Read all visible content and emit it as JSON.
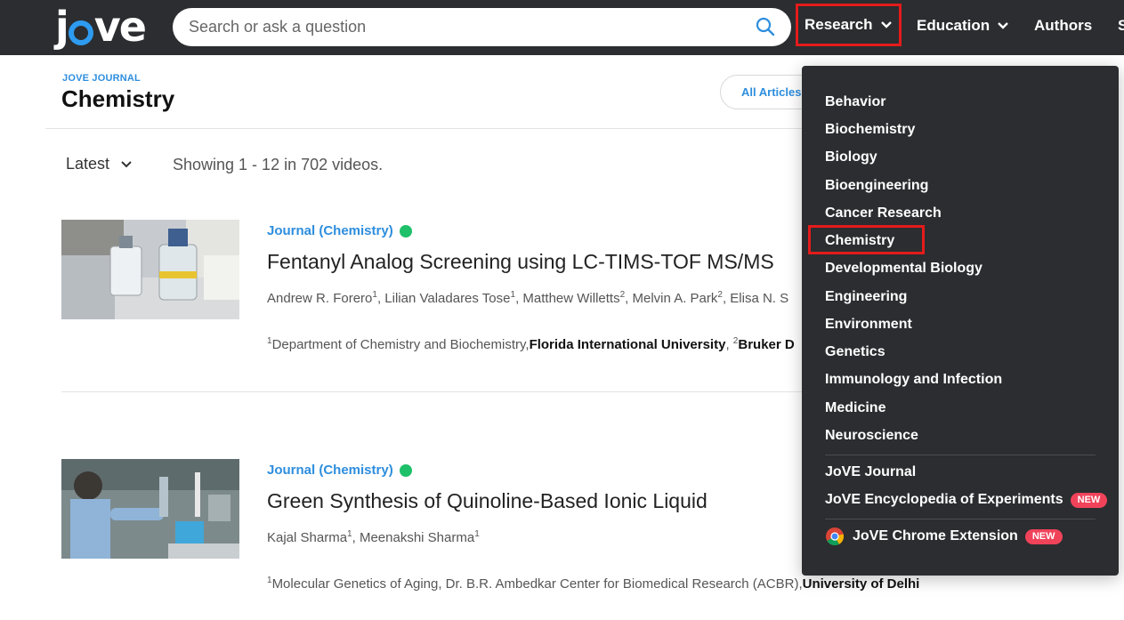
{
  "header": {
    "logo": "jove",
    "search_placeholder": "Search or ask a question",
    "nav": {
      "research": "Research",
      "education": "Education",
      "authors": "Authors",
      "more": "S"
    }
  },
  "page": {
    "tag": "JOVE JOURNAL",
    "title": "Chemistry",
    "filter_pill": "All Articles",
    "sort_label": "Latest",
    "showing": "Showing 1 - 12 in 702 videos."
  },
  "articles": [
    {
      "journal": "Journal (Chemistry)",
      "title": "Fentanyl Analog Screening using LC-TIMS-TOF MS/MS",
      "authors": [
        {
          "name": "Andrew R. Forero",
          "sup": "1"
        },
        {
          "name": "Lilian Valadares Tose",
          "sup": "1"
        },
        {
          "name": "Matthew Willetts",
          "sup": "2"
        },
        {
          "name": "Melvin A. Park",
          "sup": "2"
        },
        {
          "name": "Elisa N. S",
          "sup": ""
        }
      ],
      "affil_sup1": "1",
      "affil_dept": "Department of Chemistry and Biochemistry,",
      "affil_inst": "Florida International University",
      "affil_sep": ", ",
      "affil_sup2": "2",
      "affil_inst2": "Bruker D"
    },
    {
      "journal": "Journal (Chemistry)",
      "title": "Green Synthesis of Quinoline-Based Ionic Liquid",
      "authors": [
        {
          "name": "Kajal Sharma",
          "sup": "1"
        },
        {
          "name": "Meenakshi Sharma",
          "sup": "1"
        }
      ],
      "affil_sup1": "1",
      "affil_dept": "Molecular Genetics of Aging, Dr. B.R. Ambedkar Center for Biomedical Research (ACBR),",
      "affil_inst": "University of Delhi"
    }
  ],
  "dropdown": {
    "subjects": [
      "Behavior",
      "Biochemistry",
      "Biology",
      "Bioengineering",
      "Cancer Research",
      "Chemistry",
      "Developmental Biology",
      "Engineering",
      "Environment",
      "Genetics",
      "Immunology and Infection",
      "Medicine",
      "Neuroscience"
    ],
    "jove_journal": "JoVE Journal",
    "encyclopedia": "JoVE Encyclopedia of Experiments",
    "chrome_extension": "JoVE Chrome Extension",
    "new_badge": "NEW"
  },
  "colors": {
    "header_bg": "#2b2d30",
    "accent_blue": "#2e8ede",
    "highlight_red": "#e51b1b",
    "open_access_green": "#1ec06a",
    "new_badge": "#f0435a"
  }
}
